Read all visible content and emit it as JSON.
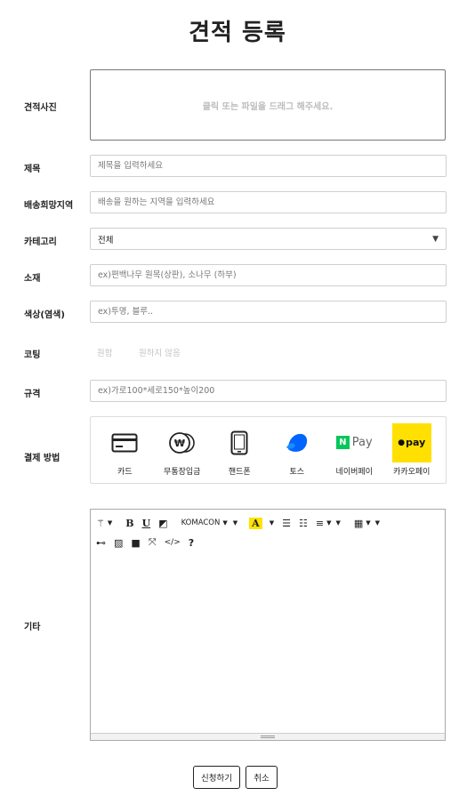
{
  "page": {
    "title": "견적 등록"
  },
  "photo": {
    "label": "견적사진",
    "hint": "클릭 또는 파일을 드래그 해주세요."
  },
  "title_field": {
    "label": "제목",
    "placeholder": "제목을 입력하세요"
  },
  "region_field": {
    "label": "배송희망지역",
    "placeholder": "배송을 원하는 지역을 입력하세요"
  },
  "category": {
    "label": "카테고리",
    "selected": "전체"
  },
  "material": {
    "label": "소재",
    "placeholder": "ex)편백나무 원목(상판), 소나무 (하부)"
  },
  "color": {
    "label": "색상(염색)",
    "placeholder": "ex)투명, 블루.."
  },
  "coating": {
    "label": "코팅",
    "options": [
      "원함",
      "원하지 않음"
    ]
  },
  "spec": {
    "label": "규격",
    "placeholder": "ex)가로100*세로150*높이200"
  },
  "payment": {
    "label": "결제 방법",
    "methods": [
      {
        "label": "카드",
        "icon": "credit-card-icon"
      },
      {
        "label": "무통장입금",
        "icon": "won-coin-icon"
      },
      {
        "label": "핸드폰",
        "icon": "mobile-phone-icon"
      },
      {
        "label": "토스",
        "icon": "toss-icon"
      },
      {
        "label": "네이버페이",
        "icon": "naver-pay-icon",
        "badge": "N",
        "text": "Pay"
      },
      {
        "label": "카카오페이",
        "icon": "kakao-pay-icon",
        "text": "pay"
      }
    ],
    "colors": {
      "naver": "#03c75a",
      "kakao": "#ffe000",
      "toss": "#0064ff"
    }
  },
  "etc": {
    "label": "기타",
    "toolbar": {
      "font_name": "KOMACON",
      "bold": "B",
      "underline": "U",
      "font_color": "A",
      "help": "?"
    }
  },
  "buttons": {
    "submit": "신청하기",
    "cancel": "취소"
  }
}
